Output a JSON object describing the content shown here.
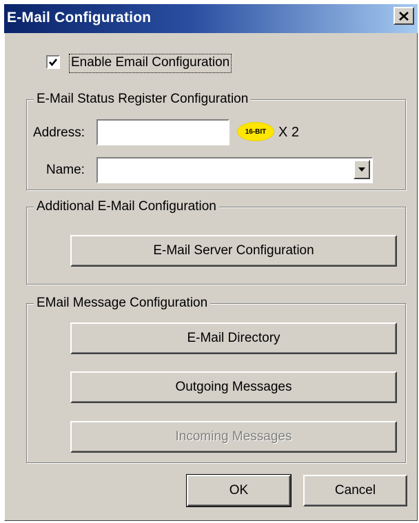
{
  "window": {
    "title": "E-Mail Configuration",
    "close_label": "×"
  },
  "enable": {
    "label": "Enable Email Configuration",
    "checked": true
  },
  "status_group": {
    "title": "E-Mail Status Register Configuration",
    "address_label": "Address:",
    "address_value": "",
    "badge": "16-BIT",
    "multiplier": "X 2",
    "name_label": "Name:",
    "name_value": ""
  },
  "additional_group": {
    "title": "Additional E-Mail Configuration",
    "server_button": "E-Mail Server Configuration"
  },
  "message_group": {
    "title": "EMail Message Configuration",
    "directory_button": "E-Mail Directory",
    "outgoing_button": "Outgoing Messages",
    "incoming_button": "Incoming Messages"
  },
  "footer": {
    "ok": "OK",
    "cancel": "Cancel"
  },
  "colors": {
    "face": "#d4d0c8",
    "title_start": "#0a246a",
    "title_end": "#a6caf0",
    "badge": "#ffe600"
  }
}
